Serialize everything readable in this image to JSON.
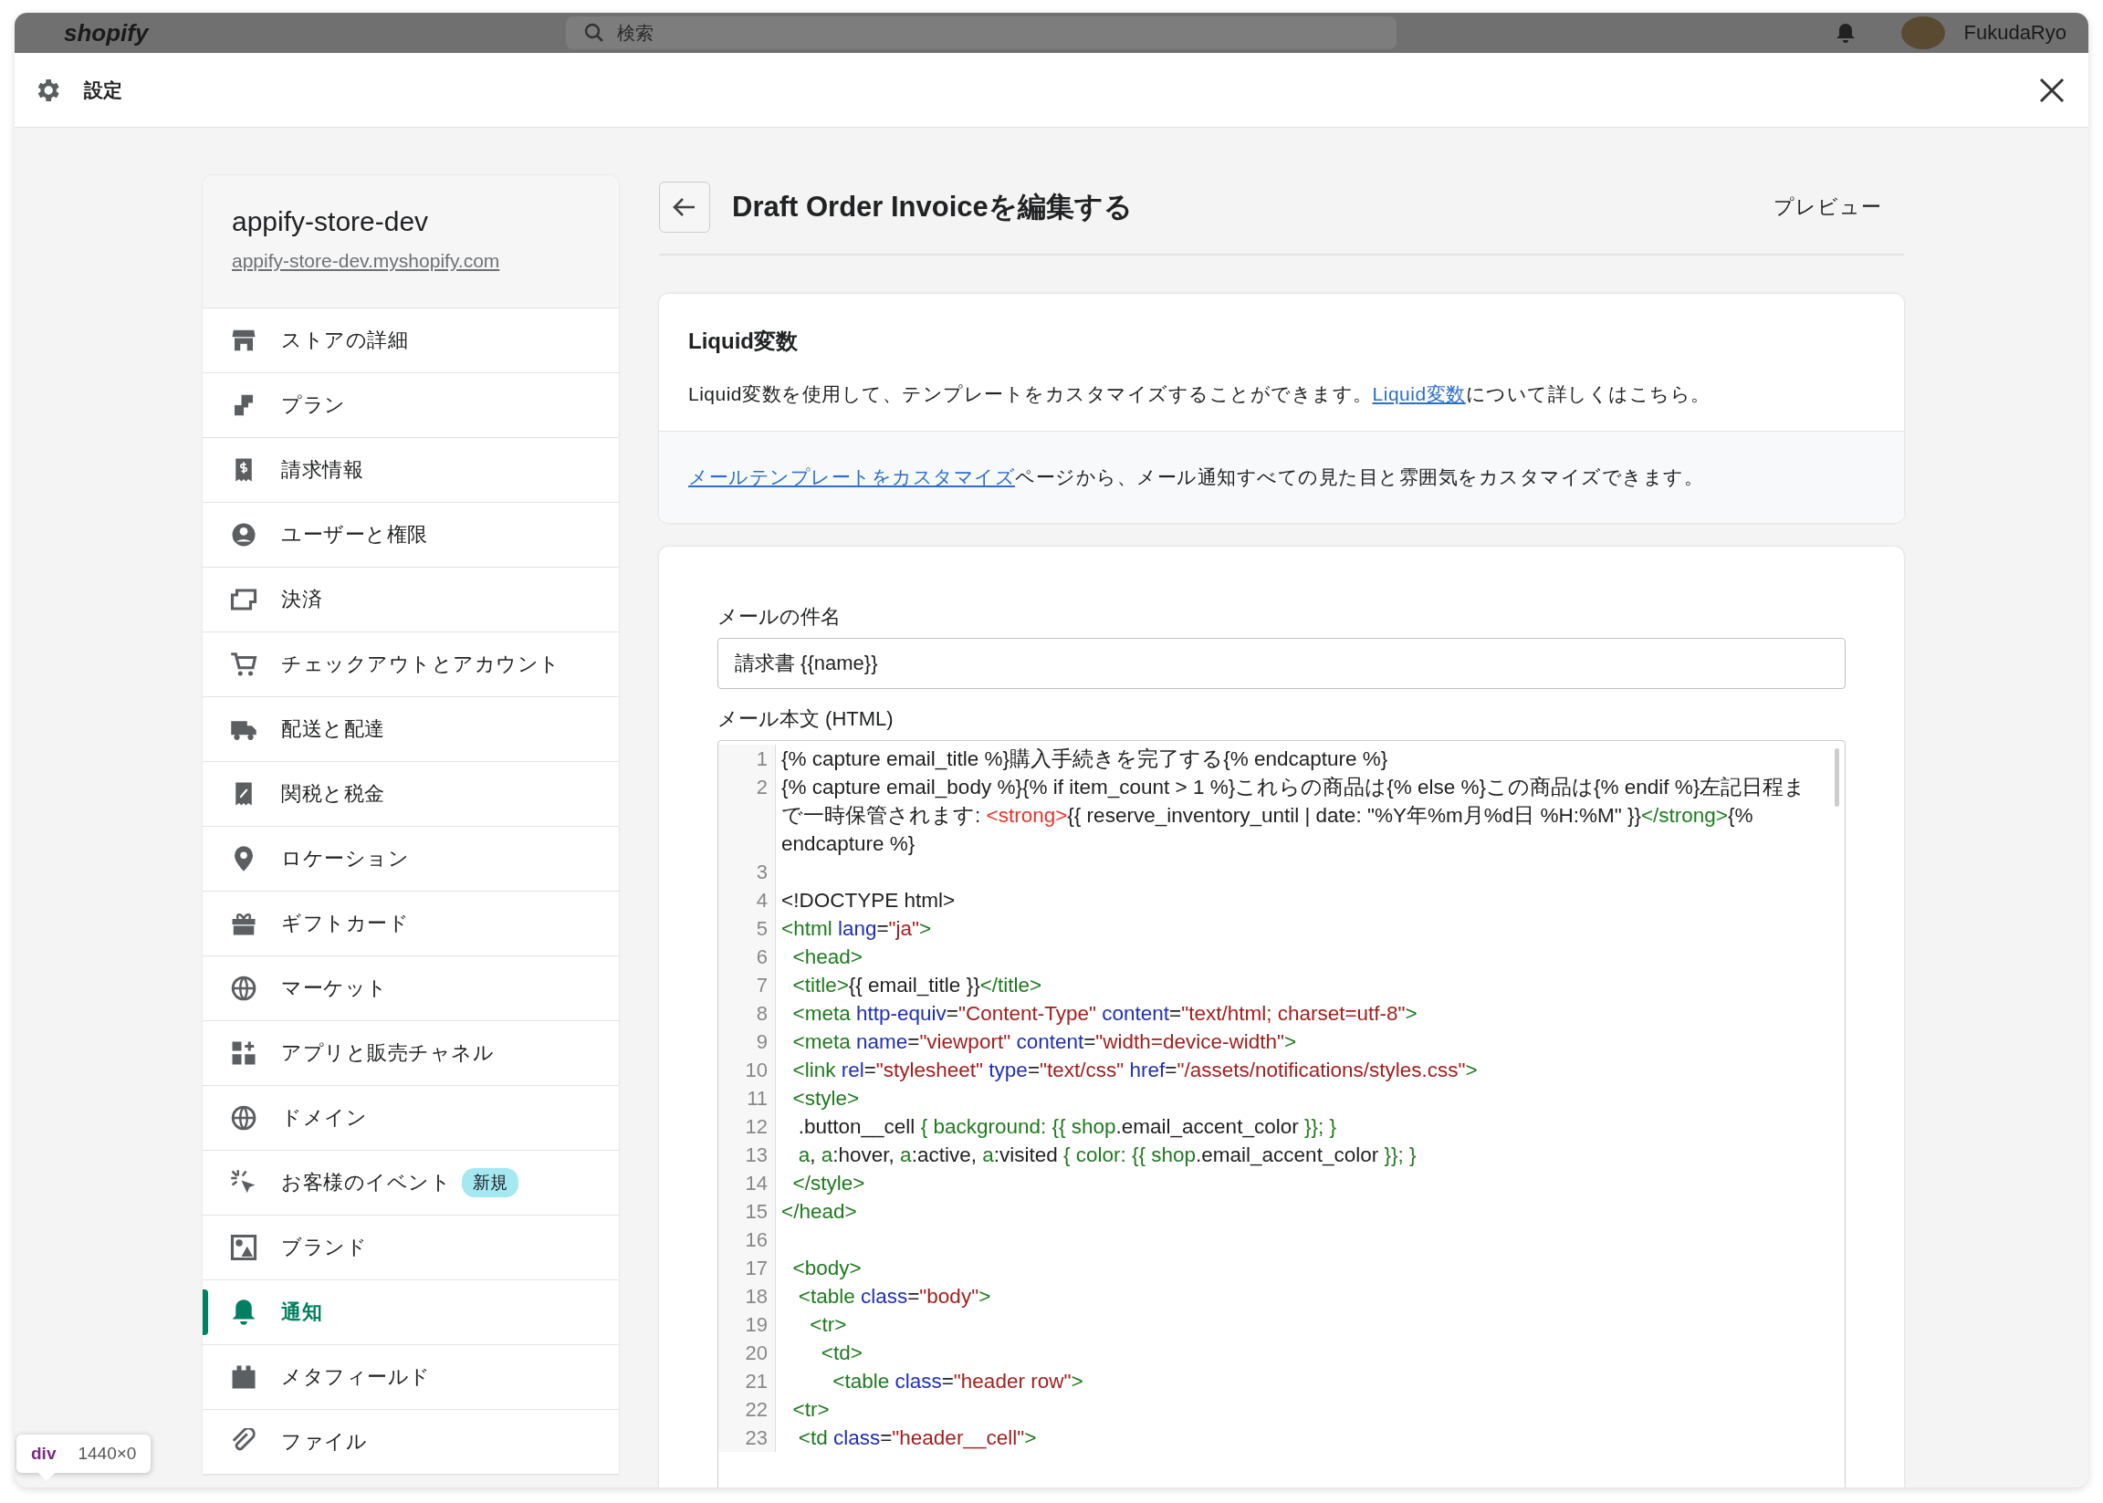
{
  "top_bar": {
    "logo": "shopify",
    "search_placeholder": "検索",
    "user": "FukudaRyo"
  },
  "modal": {
    "title": "設定"
  },
  "sidebar": {
    "store_name": "appify-store-dev",
    "store_url": "appify-store-dev.myshopify.com",
    "items": [
      {
        "label": "ストアの詳細",
        "selected": false
      },
      {
        "label": "プラン",
        "selected": false
      },
      {
        "label": "請求情報",
        "selected": false
      },
      {
        "label": "ユーザーと権限",
        "selected": false
      },
      {
        "label": "決済",
        "selected": false
      },
      {
        "label": "チェックアウトとアカウント",
        "selected": false
      },
      {
        "label": "配送と配達",
        "selected": false
      },
      {
        "label": "関税と税金",
        "selected": false
      },
      {
        "label": "ロケーション",
        "selected": false
      },
      {
        "label": "ギフトカード",
        "selected": false
      },
      {
        "label": "マーケット",
        "selected": false
      },
      {
        "label": "アプリと販売チャネル",
        "selected": false
      },
      {
        "label": "ドメイン",
        "selected": false
      },
      {
        "label": "お客様のイベント",
        "selected": false,
        "badge": "新規"
      },
      {
        "label": "ブランド",
        "selected": false
      },
      {
        "label": "通知",
        "selected": true
      },
      {
        "label": "メタフィールド",
        "selected": false
      },
      {
        "label": "ファイル",
        "selected": false
      }
    ]
  },
  "page": {
    "title": "Draft Order Invoiceを編集する",
    "preview": "プレビュー"
  },
  "liquid_card": {
    "heading": "Liquid変数",
    "text_before": "Liquid変数を使用して、テンプレートをカスタマイズすることができます。",
    "link": "Liquid変数",
    "text_after": "について詳しくはこちら。",
    "footer_link": "メールテンプレートをカスタマイズ",
    "footer_text": "ページから、メール通知すべての見た目と雰囲気をカスタマイズできます。"
  },
  "form": {
    "subject_label": "メールの件名",
    "subject_value": "請求書 {{name}}",
    "body_label": "メール本文 (HTML)",
    "code_lines": [
      {
        "number": "1",
        "tokens": [
          {
            "kind": "plain",
            "text": "{% capture email_title %}購入手続きを完了する{% endcapture %}"
          }
        ]
      },
      {
        "number": "2",
        "tokens": [
          {
            "kind": "plain",
            "text": "{% capture email_body %}{% if item_count > 1 %}これらの商品は{% else %}この商品は{% endif %}左記日程まで一時保管されます: "
          },
          {
            "kind": "error",
            "text": "<strong>"
          },
          {
            "kind": "plain",
            "text": "{{ reserve_inventory_until | date: \"%Y年%m月%d日 %H:%M\" }}"
          },
          {
            "kind": "tag",
            "text": "</strong>"
          },
          {
            "kind": "plain",
            "text": "{% endcapture %}"
          }
        ]
      },
      {
        "number": "3"
      },
      {
        "number": "4",
        "tokens": [
          {
            "kind": "plain",
            "text": "<!DOCTYPE html>"
          }
        ]
      },
      {
        "number": "5",
        "tokens": [
          {
            "kind": "tag",
            "text": "<html "
          },
          {
            "kind": "attr",
            "text": "lang"
          },
          {
            "kind": "plain",
            "text": "="
          },
          {
            "kind": "string",
            "text": "\"ja\""
          },
          {
            "kind": "tag",
            "text": ">"
          }
        ]
      },
      {
        "number": "6",
        "tokens": [
          {
            "kind": "tag",
            "text": "  <head>"
          }
        ]
      },
      {
        "number": "7",
        "tokens": [
          {
            "kind": "tag",
            "text": "  <title>"
          },
          {
            "kind": "plain",
            "text": "{{ email_title }}"
          },
          {
            "kind": "tag",
            "text": "</title>"
          }
        ]
      },
      {
        "number": "8",
        "tokens": [
          {
            "kind": "tag",
            "text": "  <meta "
          },
          {
            "kind": "attr",
            "text": "http-equiv"
          },
          {
            "kind": "plain",
            "text": "="
          },
          {
            "kind": "string",
            "text": "\"Content-Type\" "
          },
          {
            "kind": "attr",
            "text": "content"
          },
          {
            "kind": "plain",
            "text": "="
          },
          {
            "kind": "string",
            "text": "\"text/html; charset=utf-8\""
          },
          {
            "kind": "tag",
            "text": ">"
          }
        ]
      },
      {
        "number": "9",
        "tokens": [
          {
            "kind": "tag",
            "text": "  <meta "
          },
          {
            "kind": "attr",
            "text": "name"
          },
          {
            "kind": "plain",
            "text": "="
          },
          {
            "kind": "string",
            "text": "\"viewport\" "
          },
          {
            "kind": "attr",
            "text": "content"
          },
          {
            "kind": "plain",
            "text": "="
          },
          {
            "kind": "string",
            "text": "\"width=device-width\""
          },
          {
            "kind": "tag",
            "text": ">"
          }
        ]
      },
      {
        "number": "10",
        "tokens": [
          {
            "kind": "tag",
            "text": "  <link "
          },
          {
            "kind": "attr",
            "text": "rel"
          },
          {
            "kind": "plain",
            "text": "="
          },
          {
            "kind": "string",
            "text": "\"stylesheet\" "
          },
          {
            "kind": "attr",
            "text": "type"
          },
          {
            "kind": "plain",
            "text": "="
          },
          {
            "kind": "string",
            "text": "\"text/css\" "
          },
          {
            "kind": "attr",
            "text": "href"
          },
          {
            "kind": "plain",
            "text": "="
          },
          {
            "kind": "string",
            "text": "\"/assets/notifications/styles.css\""
          },
          {
            "kind": "tag",
            "text": ">"
          }
        ]
      },
      {
        "number": "11",
        "tokens": [
          {
            "kind": "tag",
            "text": "  <style>"
          }
        ]
      },
      {
        "number": "12",
        "tokens": [
          {
            "kind": "plain",
            "text": "   .button__cell "
          },
          {
            "kind": "tag",
            "text": "{ background: {{ shop"
          },
          {
            "kind": "plain",
            "text": ".email_accent_color "
          },
          {
            "kind": "tag",
            "text": "}}; }"
          }
        ]
      },
      {
        "number": "13",
        "tokens": [
          {
            "kind": "tag",
            "text": "   a"
          },
          {
            "kind": "plain",
            "text": ", "
          },
          {
            "kind": "tag",
            "text": "a"
          },
          {
            "kind": "plain",
            "text": ":hover, "
          },
          {
            "kind": "tag",
            "text": "a"
          },
          {
            "kind": "plain",
            "text": ":active, "
          },
          {
            "kind": "tag",
            "text": "a"
          },
          {
            "kind": "plain",
            "text": ":visited "
          },
          {
            "kind": "tag",
            "text": "{ color: {{ shop"
          },
          {
            "kind": "plain",
            "text": ".email_accent_color "
          },
          {
            "kind": "tag",
            "text": "}}; }"
          }
        ]
      },
      {
        "number": "14",
        "tokens": [
          {
            "kind": "tag",
            "text": "  </style>"
          }
        ]
      },
      {
        "number": "15",
        "tokens": [
          {
            "kind": "tag",
            "text": "</head>"
          }
        ]
      },
      {
        "number": "16"
      },
      {
        "number": "17",
        "tokens": [
          {
            "kind": "tag",
            "text": "  <body>"
          }
        ]
      },
      {
        "number": "18",
        "tokens": [
          {
            "kind": "tag",
            "text": "   <table "
          },
          {
            "kind": "attr",
            "text": "class"
          },
          {
            "kind": "plain",
            "text": "="
          },
          {
            "kind": "string",
            "text": "\"body\""
          },
          {
            "kind": "tag",
            "text": ">"
          }
        ]
      },
      {
        "number": "19",
        "tokens": [
          {
            "kind": "tag",
            "text": "     <tr>"
          }
        ]
      },
      {
        "number": "20",
        "tokens": [
          {
            "kind": "tag",
            "text": "       <td>"
          }
        ]
      },
      {
        "number": "21",
        "tokens": [
          {
            "kind": "tag",
            "text": "         <table "
          },
          {
            "kind": "attr",
            "text": "class"
          },
          {
            "kind": "plain",
            "text": "="
          },
          {
            "kind": "string",
            "text": "\"header row\""
          },
          {
            "kind": "tag",
            "text": ">"
          }
        ]
      },
      {
        "number": "22",
        "tokens": [
          {
            "kind": "tag",
            "text": "  <tr>"
          }
        ]
      },
      {
        "number": "23",
        "tokens": [
          {
            "kind": "tag",
            "text": "   <td "
          },
          {
            "kind": "attr",
            "text": "class"
          },
          {
            "kind": "plain",
            "text": "="
          },
          {
            "kind": "string",
            "text": "\"header__cell\""
          },
          {
            "kind": "tag",
            "text": ">"
          }
        ]
      }
    ]
  },
  "devtools_tooltip": {
    "element": "div",
    "size": "1440×0"
  }
}
